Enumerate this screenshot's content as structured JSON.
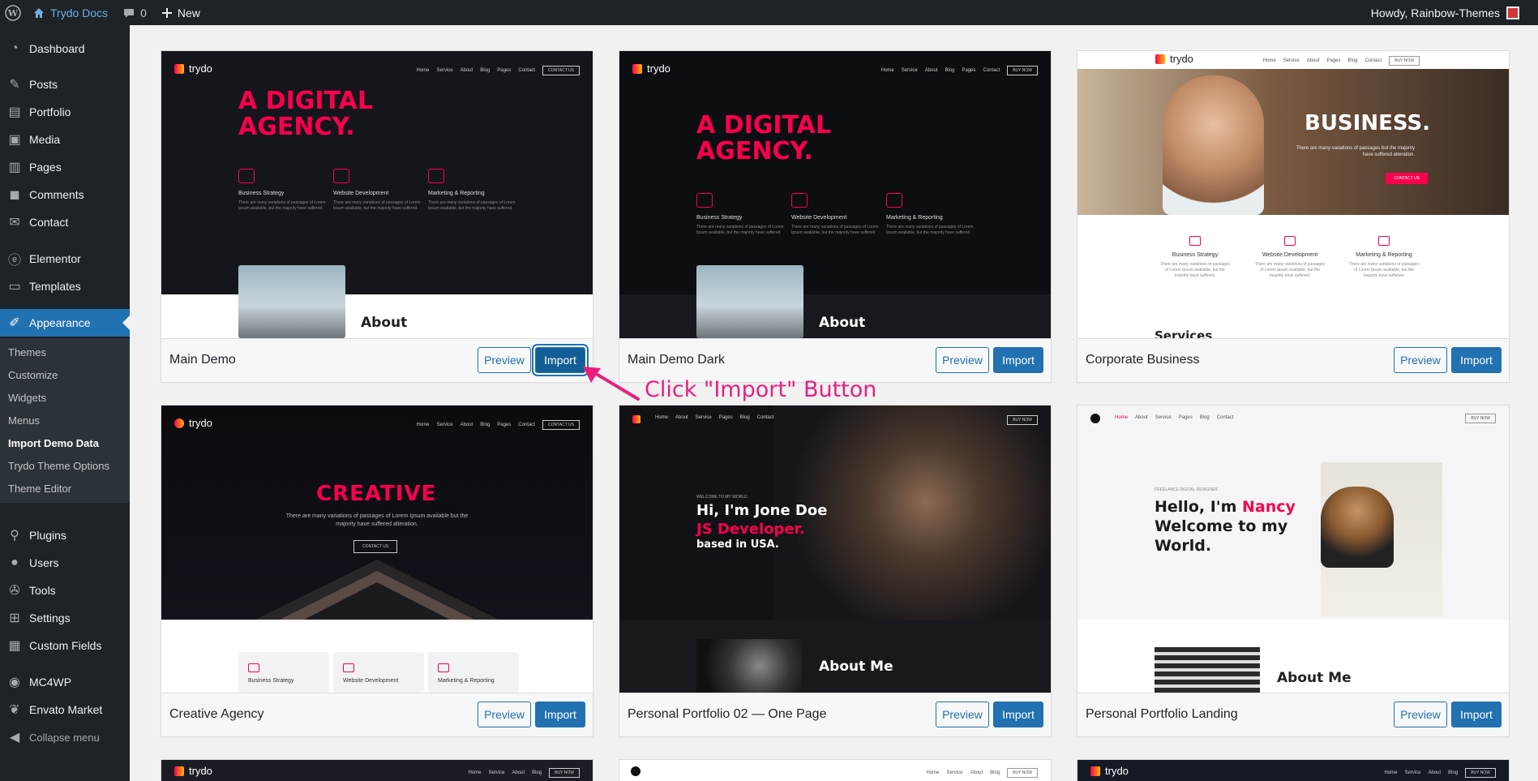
{
  "admin_bar": {
    "site_name": "Trydo Docs",
    "comment_count": "0",
    "new_label": "New",
    "howdy": "Howdy, Rainbow-Themes"
  },
  "sidebar": {
    "items": [
      {
        "label": "Dashboard",
        "icon": "dashboard-icon"
      },
      {
        "label": "Posts",
        "icon": "pin-icon"
      },
      {
        "label": "Portfolio",
        "icon": "portfolio-icon"
      },
      {
        "label": "Media",
        "icon": "media-icon"
      },
      {
        "label": "Pages",
        "icon": "pages-icon"
      },
      {
        "label": "Comments",
        "icon": "comments-icon"
      },
      {
        "label": "Contact",
        "icon": "mail-icon"
      },
      {
        "label": "Elementor",
        "icon": "elementor-icon"
      },
      {
        "label": "Templates",
        "icon": "folder-icon"
      },
      {
        "label": "Appearance",
        "icon": "brush-icon"
      },
      {
        "label": "Plugins",
        "icon": "plugin-icon"
      },
      {
        "label": "Users",
        "icon": "user-icon"
      },
      {
        "label": "Tools",
        "icon": "wrench-icon"
      },
      {
        "label": "Settings",
        "icon": "settings-icon"
      },
      {
        "label": "Custom Fields",
        "icon": "grid-icon"
      },
      {
        "label": "MC4WP",
        "icon": "mc4wp-icon"
      },
      {
        "label": "Envato Market",
        "icon": "leaf-icon"
      },
      {
        "label": "Collapse menu",
        "icon": "collapse-icon"
      }
    ],
    "submenu": [
      "Themes",
      "Customize",
      "Widgets",
      "Menus",
      "Import Demo Data",
      "Trydo Theme Options",
      "Theme Editor"
    ],
    "active_submenu": "Import Demo Data"
  },
  "demos": [
    {
      "name": "Main Demo",
      "preview": "Preview",
      "import": "Import"
    },
    {
      "name": "Main Demo Dark",
      "preview": "Preview",
      "import": "Import"
    },
    {
      "name": "Corporate Business",
      "preview": "Preview",
      "import": "Import"
    },
    {
      "name": "Creative Agency",
      "preview": "Preview",
      "import": "Import"
    },
    {
      "name": "Personal Portfolio 02 — One Page",
      "preview": "Preview",
      "import": "Import"
    },
    {
      "name": "Personal Portfolio Landing",
      "preview": "Preview",
      "import": "Import"
    }
  ],
  "shots": {
    "logo": "trydo",
    "nav": [
      "Home",
      "Service",
      "About",
      "Blog",
      "Pages",
      "Contact"
    ],
    "contact_cta": "CONTACT US",
    "buy_cta": "BUY NOW",
    "agency_line1": "A DIGITAL",
    "agency_line2": "AGENCY.",
    "svc1": "Business Strategy",
    "svc2": "Website Development",
    "svc3": "Marketing & Reporting",
    "svc_desc": "There are many variations of passages of Lorem Ipsum available, but the majority have suffered.",
    "about": "About",
    "business": "BUSINESS.",
    "business_sub": "There are many variations of passages but the majority have suffered alteration.",
    "services": "Services",
    "creative": "CREATIVE",
    "creative_sub": "There are many variations of passages of Lorem Ipsum available but the majority have suffered alteration.",
    "jone_line1": "Hi, I'm Jone Doe",
    "jone_line2": "JS Developer.",
    "jone_line3": "based in USA.",
    "welcome": "WELCOME TO MY WORLD",
    "about_me": "About Me",
    "freelance": "FREELANCE DIGITAL DESIGNER",
    "nancy_pre": "Hello, I'm ",
    "nancy_name": "Nancy",
    "nancy_line2": "Welcome to my",
    "nancy_line3": "World."
  },
  "annotation": "Click \"Import\" Button",
  "colors": {
    "accent": "#2271b1",
    "brand": "#f9004d",
    "annotation": "#e8207f"
  }
}
